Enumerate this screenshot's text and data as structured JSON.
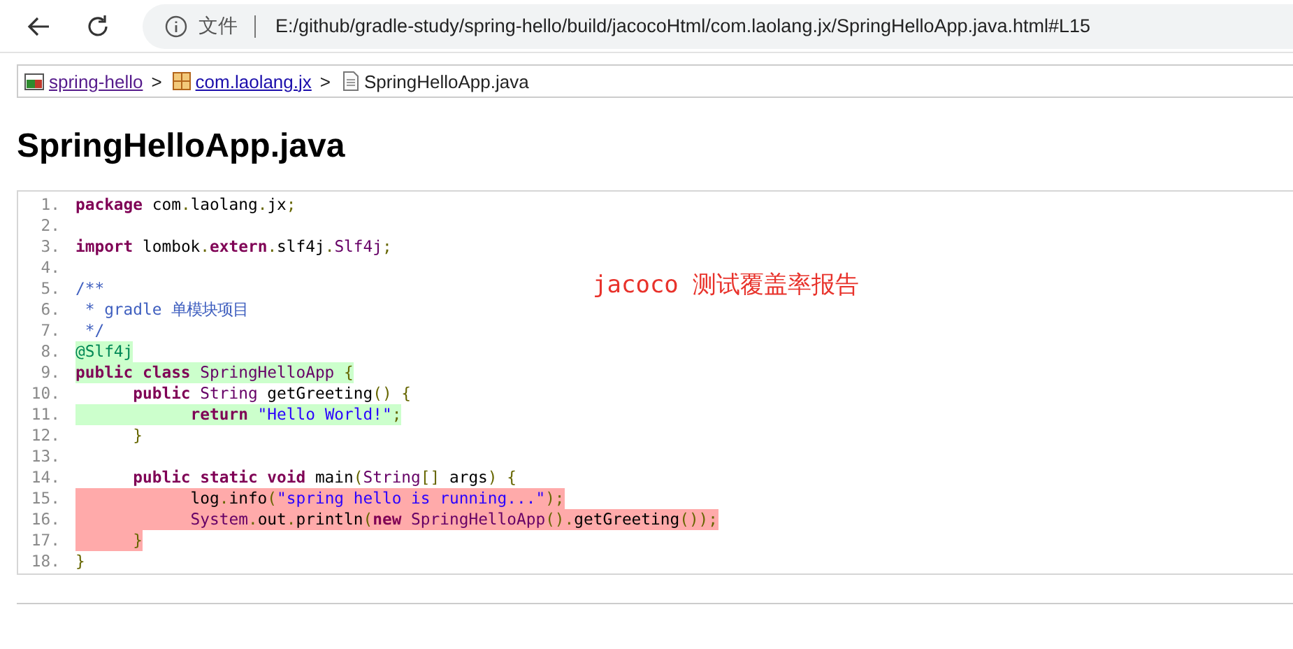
{
  "browser": {
    "scheme_label": "文件",
    "url": "E:/github/gradle-study/spring-hello/build/jacocoHtml/com.laolang.jx/SpringHelloApp.java.html#L15"
  },
  "breadcrumb": [
    {
      "label": "spring-hello",
      "kind": "project",
      "link": true
    },
    {
      "label": "com.laolang.jx",
      "kind": "package",
      "link": true
    },
    {
      "label": "SpringHelloApp.java",
      "kind": "file",
      "link": false
    }
  ],
  "breadcrumb_separator": ">",
  "title": "SpringHelloApp.java",
  "annotation": "jacoco 测试覆盖率报告",
  "code_lines": [
    {
      "number": "1.",
      "kind": "plain",
      "tokens": [
        {
          "kind": "kwd",
          "text": "package"
        },
        {
          "kind": "pln",
          "text": " com"
        },
        {
          "kind": "pun",
          "text": "."
        },
        {
          "kind": "pln",
          "text": "laolang"
        },
        {
          "kind": "pun",
          "text": "."
        },
        {
          "kind": "pln",
          "text": "jx"
        },
        {
          "kind": "pun",
          "text": ";"
        }
      ]
    },
    {
      "number": "2."
    },
    {
      "number": "3.",
      "kind": "plain",
      "tokens": [
        {
          "kind": "kwd",
          "text": "import"
        },
        {
          "kind": "pln",
          "text": " lombok"
        },
        {
          "kind": "pun",
          "text": "."
        },
        {
          "kind": "kwd",
          "text": "extern"
        },
        {
          "kind": "pun",
          "text": "."
        },
        {
          "kind": "pln",
          "text": "slf4j"
        },
        {
          "kind": "pun",
          "text": "."
        },
        {
          "kind": "typ",
          "text": "Slf4j"
        },
        {
          "kind": "pun",
          "text": ";"
        }
      ]
    },
    {
      "number": "4."
    },
    {
      "number": "5.",
      "kind": "plain",
      "tokens": [
        {
          "kind": "com",
          "text": "/**"
        }
      ]
    },
    {
      "number": "6.",
      "kind": "plain",
      "tokens": [
        {
          "kind": "com",
          "text": " * gradle 单模块项目"
        }
      ]
    },
    {
      "number": "7.",
      "kind": "plain",
      "tokens": [
        {
          "kind": "com",
          "text": " */"
        }
      ]
    },
    {
      "number": "8.",
      "kind": "covered",
      "tokens": [
        {
          "kind": "ann",
          "text": "@Slf4j"
        }
      ]
    },
    {
      "number": "9.",
      "kind": "covered",
      "tokens": [
        {
          "kind": "kwd",
          "text": "public class"
        },
        {
          "kind": "typ",
          "text": " SpringHelloApp"
        },
        {
          "kind": "pun",
          "text": " {"
        }
      ]
    },
    {
      "number": "10.",
      "kind": "plain",
      "tokens": [
        {
          "kind": "kwd",
          "text": "      public"
        },
        {
          "kind": "typ",
          "text": " String"
        },
        {
          "kind": "pln",
          "text": " getGreeting"
        },
        {
          "kind": "pun",
          "text": "() {"
        }
      ]
    },
    {
      "number": "11.",
      "kind": "covered",
      "tokens": [
        {
          "kind": "kwd",
          "text": "            return"
        },
        {
          "kind": "str",
          "text": " \"Hello World!\""
        },
        {
          "kind": "pun",
          "text": ";"
        }
      ]
    },
    {
      "number": "12.",
      "kind": "plain",
      "tokens": [
        {
          "kind": "pun",
          "text": "      }"
        }
      ]
    },
    {
      "number": "13."
    },
    {
      "number": "14.",
      "kind": "plain",
      "tokens": [
        {
          "kind": "kwd",
          "text": "      public static void"
        },
        {
          "kind": "pln",
          "text": " main"
        },
        {
          "kind": "pun",
          "text": "("
        },
        {
          "kind": "typ",
          "text": "String"
        },
        {
          "kind": "pun",
          "text": "[]"
        },
        {
          "kind": "pln",
          "text": " args"
        },
        {
          "kind": "pun",
          "text": ") {"
        }
      ]
    },
    {
      "number": "15.",
      "kind": "missed",
      "tokens": [
        {
          "kind": "pln",
          "text": "            log"
        },
        {
          "kind": "pun",
          "text": "."
        },
        {
          "kind": "pln",
          "text": "info"
        },
        {
          "kind": "pun",
          "text": "("
        },
        {
          "kind": "str",
          "text": "\"spring hello is running...\""
        },
        {
          "kind": "pun",
          "text": ");"
        }
      ]
    },
    {
      "number": "16.",
      "kind": "missed",
      "tokens": [
        {
          "kind": "typ",
          "text": "            System"
        },
        {
          "kind": "pun",
          "text": "."
        },
        {
          "kind": "pln",
          "text": "out"
        },
        {
          "kind": "pun",
          "text": "."
        },
        {
          "kind": "pln",
          "text": "println"
        },
        {
          "kind": "pun",
          "text": "("
        },
        {
          "kind": "kwd",
          "text": "new"
        },
        {
          "kind": "typ",
          "text": " SpringHelloApp"
        },
        {
          "kind": "pun",
          "text": "()."
        },
        {
          "kind": "pln",
          "text": "getGreeting"
        },
        {
          "kind": "pun",
          "text": "());"
        }
      ]
    },
    {
      "number": "17.",
      "kind": "missed",
      "tokens": [
        {
          "kind": "pun",
          "text": "      }"
        }
      ]
    },
    {
      "number": "18.",
      "kind": "plain",
      "tokens": [
        {
          "kind": "pun",
          "text": "}"
        }
      ]
    }
  ]
}
